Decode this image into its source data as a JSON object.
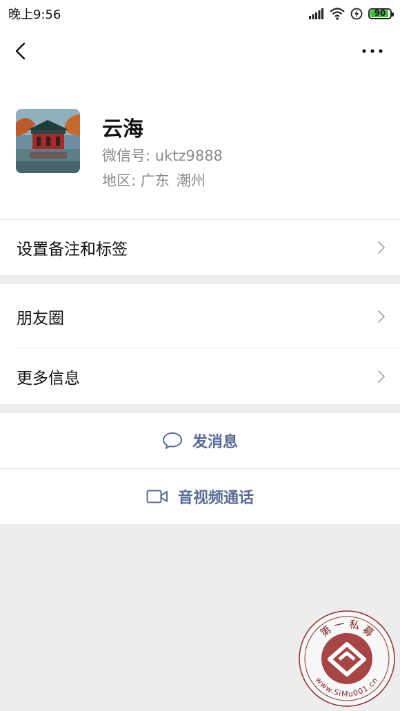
{
  "status_bar": {
    "time": "晚上9:56",
    "battery_level": "90"
  },
  "nav": {
    "back_icon": "back-chevron-icon",
    "more_icon": "more-dots-icon"
  },
  "profile": {
    "name": "云海",
    "wechat_id": "微信号: uktz9888",
    "region_label": "地区: 广东",
    "region_city": "潮州"
  },
  "cells": {
    "remark_tags": "设置备注和标签",
    "moments": "朋友圈",
    "more_info": "更多信息"
  },
  "actions": {
    "send_message": "发消息",
    "video_call": "音视频通话"
  },
  "watermark": {
    "top_text": "第 一 私 募",
    "bottom_text": "www.SiMu001.cn"
  },
  "colors": {
    "link_blue": "#576b95",
    "battery_green": "#35c535",
    "page_bg": "#ededed"
  }
}
